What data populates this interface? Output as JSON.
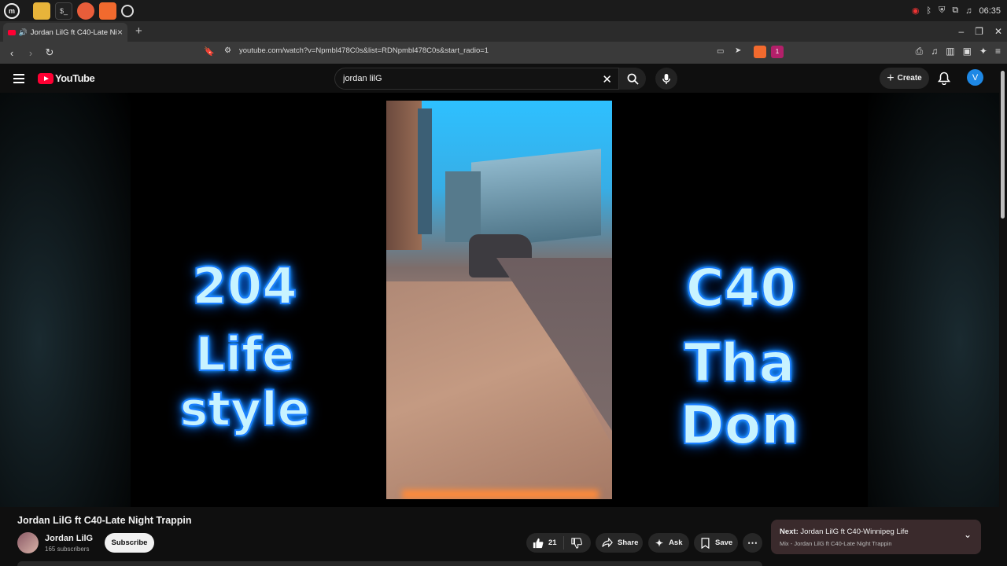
{
  "taskbar": {
    "clock": "06:35"
  },
  "browser": {
    "tab_title": "Jordan LilG ft C40-Late Nig",
    "tab_close": "×",
    "new_tab": "+",
    "url": "youtube.com/watch?v=Npmbl478C0s&list=RDNpmbl478C0s&start_radio=1",
    "extension_badge": "1"
  },
  "youtube": {
    "logo_text": "YouTube",
    "search_value": "jordan lilG",
    "create_label": "Create",
    "avatar_letter": "V"
  },
  "video": {
    "overlay_left_line1": "204",
    "overlay_left_line2": "Life style",
    "overlay_right_line1": "C40",
    "overlay_right_line2": "Tha Don",
    "title": "Jordan LilG ft C40-Late Night Trappin"
  },
  "channel": {
    "name": "Jordan LilG",
    "subscribers": "165 subscribers",
    "subscribe_label": "Subscribe"
  },
  "actions": {
    "like_count": "21",
    "share_label": "Share",
    "ask_label": "Ask",
    "save_label": "Save"
  },
  "next": {
    "prefix": "Next:",
    "title": "Jordan LilG ft C40-Winnipeg Life",
    "subtitle": "Mix - Jordan LilG ft C40-Late Night Trappin"
  },
  "colors": {
    "youtube_red": "#ff0033",
    "neon_blue": "#1c7fff",
    "avatar_blue": "#1e88e5"
  }
}
